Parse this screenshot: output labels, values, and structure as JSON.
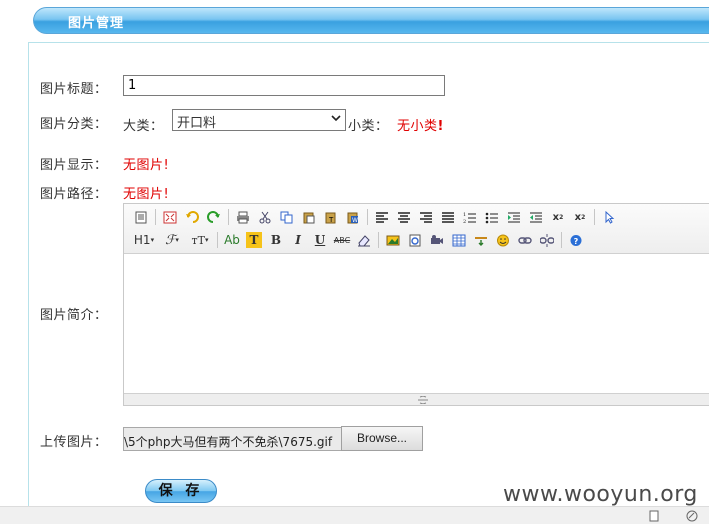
{
  "header": {
    "title": "图片管理"
  },
  "form": {
    "title_label": "图片标题：",
    "title_value": "1",
    "category_label": "图片分类：",
    "big_category_label": "大类：",
    "big_category_selected": "开口料",
    "small_category_label": "小类：",
    "small_category_none": "无小类",
    "exclaim": "!",
    "display_label": "图片显示：",
    "display_value": "无图片!",
    "path_label": "图片路径：",
    "path_value": "无图片!",
    "intro_label": "图片简介：",
    "upload_label": "上传图片：",
    "upload_file_value": "\\5个php大马但有两个不免杀\\7675.gif",
    "browse_label": "Browse...",
    "save_label": "保 存"
  },
  "editor": {
    "row2_labels": {
      "heading": "H1",
      "font": "ℱ",
      "size": "тT",
      "forecolor": "Ab",
      "backcolor": "T",
      "bold": "B",
      "italic": "I",
      "underline": "U",
      "strike": "ABC"
    },
    "icons": [
      "source-icon",
      "fullscreen-icon",
      "undo-icon",
      "redo-icon",
      "print-icon",
      "cut-icon",
      "copy-icon",
      "paste-icon",
      "paste-text-icon",
      "paste-word-icon",
      "align-left-icon",
      "align-center-icon",
      "align-right-icon",
      "align-justify-icon",
      "ordered-list-icon",
      "unordered-list-icon",
      "indent-icon",
      "outdent-icon",
      "subscript-icon",
      "superscript-icon",
      "select-all-icon",
      "image-icon",
      "flash-icon",
      "media-icon",
      "table-icon",
      "hr-icon",
      "emoticon-icon",
      "link-icon",
      "unlink-icon",
      "help-icon"
    ]
  },
  "watermark": "www.wooyun.org"
}
